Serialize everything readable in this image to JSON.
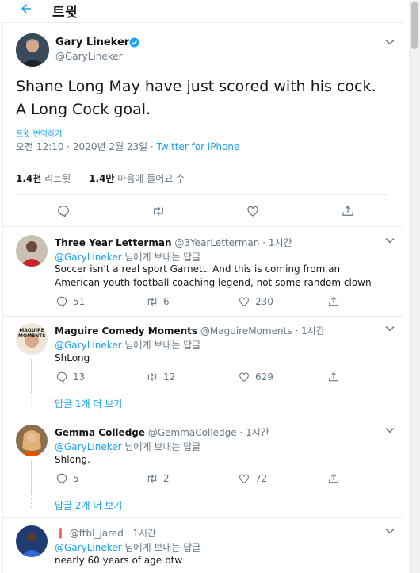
{
  "header": {
    "title": "트윗"
  },
  "main_tweet": {
    "name": "Gary Lineker",
    "handle": "@GaryLineker",
    "text": "Shane Long May have just scored with his cock. A Long Cock goal.",
    "translate": "트윗 번역하기",
    "timestamp": "오전 12:10 · 2020년 2월 23일 · ",
    "source": "Twitter for iPhone",
    "retweets_count": "1.4천",
    "retweets_label": "리트윗",
    "likes_count": "1.4만",
    "likes_label": "마음에 들어요 수"
  },
  "replies": [
    {
      "name": "Three Year Letterman",
      "handle": "@3YearLetterman · 1시간",
      "reply_to_user": "@GaryLineker",
      "reply_to_suffix": "님에게 보내는 답글",
      "text": "Soccer isn't a real sport Garnett. And this is coming from an American youth football coaching legend, not some random clown",
      "reply_count": "51",
      "retweet_count": "6",
      "like_count": "230"
    },
    {
      "name": "Maguire Comedy Moments",
      "handle": "@MaguireMoments · 1시간",
      "reply_to_user": "@GaryLineker",
      "reply_to_suffix": "님에게 보내는 답글",
      "text": "ShLong",
      "reply_count": "13",
      "retweet_count": "12",
      "like_count": "629",
      "more_replies": "답글 1개 더 보기",
      "avatar_text": "MAGUIRE MOMENTS"
    },
    {
      "name": "Gemma Colledge",
      "handle": "@GemmaColledge · 1시간",
      "reply_to_user": "@GaryLineker",
      "reply_to_suffix": "님에게 보내는 답글",
      "text": "Shlong.",
      "reply_count": "5",
      "retweet_count": "2",
      "like_count": "72",
      "more_replies": "답글 2개 더 보기"
    },
    {
      "name": "❗",
      "handle": "@ftbl_jared · 1시간",
      "reply_to_user": "@GaryLineker",
      "reply_to_suffix": "님에게 보내는 답글",
      "text": "nearly 60 years of age btw"
    }
  ],
  "colors": {
    "accent": "#1da1f2",
    "text": "#14171a",
    "muted": "#657786",
    "border": "#e6ecf0"
  }
}
